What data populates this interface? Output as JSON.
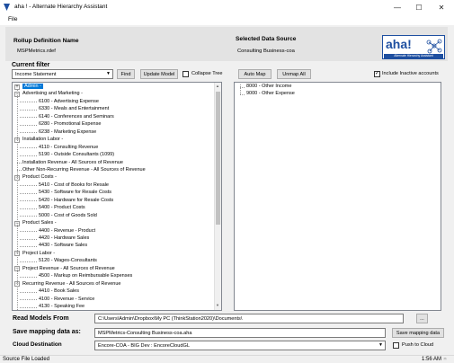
{
  "window": {
    "title": "aha ! - Alternate Hierarchy Assistant",
    "minimize": "—",
    "maximize": "☐",
    "close": "✕"
  },
  "menu": {
    "file": "File"
  },
  "header": {
    "rollup_title": "Rollup Definition Name",
    "rollup_value": "MSPMetrics.rdef",
    "source_title": "Selected Data Source",
    "source_value": "Consulting Business-coa",
    "logo_text": "aha!",
    "logo_sub": "Alternate Hierarchy Assistant"
  },
  "filter": {
    "label": "Current filter",
    "selected": "Income Statement",
    "find_label": "Find",
    "update_label": "Update Model",
    "collapse_label": "Collapse Tree",
    "collapse_checked": false
  },
  "right_toolbar": {
    "auto_map": "Auto Map",
    "unmap_all": "Unmap All",
    "include_inactive": "Include Inactive accounts",
    "include_checked": true
  },
  "tree": [
    {
      "level": 0,
      "text": "Admin -",
      "expander": "+",
      "selected": true
    },
    {
      "level": 0,
      "text": "Advertising and Marketing -",
      "expander": "−"
    },
    {
      "level": 1,
      "text": "6100 - Advertising Expense"
    },
    {
      "level": 1,
      "text": "6330 - Meals and Entertainment"
    },
    {
      "level": 1,
      "text": "6140 - Conferences and Seminars"
    },
    {
      "level": 1,
      "text": "6280 - Promotional Expense"
    },
    {
      "level": 1,
      "text": "6238 - Marketing Expense"
    },
    {
      "level": 0,
      "text": "Installation Labor -",
      "expander": "−"
    },
    {
      "level": 1,
      "text": "4110 - Consulting Revenue"
    },
    {
      "level": 1,
      "text": "5190 - Outside Consultants (1099)"
    },
    {
      "level": 0,
      "text": "Installation Revenue - All Sources of Revenue"
    },
    {
      "level": 0,
      "text": "Other Non-Recurring Revenue - All Sources of Revenue"
    },
    {
      "level": 0,
      "text": "Product Costs -",
      "expander": "−"
    },
    {
      "level": 1,
      "text": "5410 - Cost of Books for Resale"
    },
    {
      "level": 1,
      "text": "5430 - Software for Resale Costs"
    },
    {
      "level": 1,
      "text": "5420 - Hardware for Resale Costs"
    },
    {
      "level": 1,
      "text": "5400 - Product Costs"
    },
    {
      "level": 1,
      "text": "5000 - Cost of Goods Sold"
    },
    {
      "level": 0,
      "text": "Product Sales -",
      "expander": "−"
    },
    {
      "level": 1,
      "text": "4400 - Revenue - Product"
    },
    {
      "level": 1,
      "text": "4420 - Hardware Sales"
    },
    {
      "level": 1,
      "text": "4430 - Software Sales"
    },
    {
      "level": 0,
      "text": "Project Labor -",
      "expander": "−"
    },
    {
      "level": 1,
      "text": "5120 - Wages-Consultants"
    },
    {
      "level": 0,
      "text": "Project Revenue - All Sources of Revenue",
      "expander": "−"
    },
    {
      "level": 1,
      "text": "4500 - Markup on Reimbursable Expenses"
    },
    {
      "level": 0,
      "text": "Recurring Revenue - All Sources of Revenue",
      "expander": "−"
    },
    {
      "level": 1,
      "text": "4410 - Book Sales"
    },
    {
      "level": 1,
      "text": "4100 - Revenue - Service"
    },
    {
      "level": 1,
      "text": "4130 - Speaking Fee"
    }
  ],
  "right_tree": [
    {
      "text": "8000 - Other Income"
    },
    {
      "text": "9000 - Other Expense"
    }
  ],
  "read_models": {
    "label": "Read Models From",
    "value": "C:\\Users\\Admin\\Dropbox\\My PC (ThinkStation2020)\\Documents\\",
    "browse": "..."
  },
  "save_mapping": {
    "label": "Save mapping data as:",
    "value": "MSPMetrics-Consulting Business-coa.aha",
    "button": "Save mapping data"
  },
  "cloud": {
    "label": "Cloud Destination",
    "value": "Encore-COA - BIG Dev : EncoreCloudGL",
    "push_label": "Push to Cloud",
    "push_checked": false
  },
  "status": {
    "text": "Source File Loaded",
    "time": "1:56 AM"
  }
}
